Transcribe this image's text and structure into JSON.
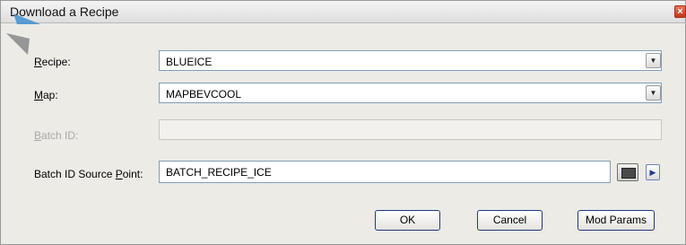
{
  "window": {
    "title": "Download a Recipe",
    "close_glyph": "×"
  },
  "form": {
    "recipe_label_first": "R",
    "recipe_label_rest": "ecipe:",
    "recipe_value": "BLUEICE",
    "map_label_first": "M",
    "map_label_rest": "ap:",
    "map_value": "MAPBEVCOOL",
    "batch_id_label_first": "B",
    "batch_id_label_rest": "atch ID:",
    "batch_id_value": "",
    "source_label_prefix": "Batch ID Source ",
    "source_label_underlined": "P",
    "source_label_rest": "oint:",
    "source_value": "BATCH_RECIPE_ICE",
    "dropdown_glyph": "▼",
    "arrow_glyph": "▶"
  },
  "buttons": {
    "ok": "OK",
    "cancel": "Cancel",
    "mod_params": "Mod Params"
  },
  "colors": {
    "dialog_background": "#ecebe5",
    "field_border": "#7f9db9",
    "button_border": "#1f3a82",
    "pointer_accent": "#3f8fd2"
  }
}
